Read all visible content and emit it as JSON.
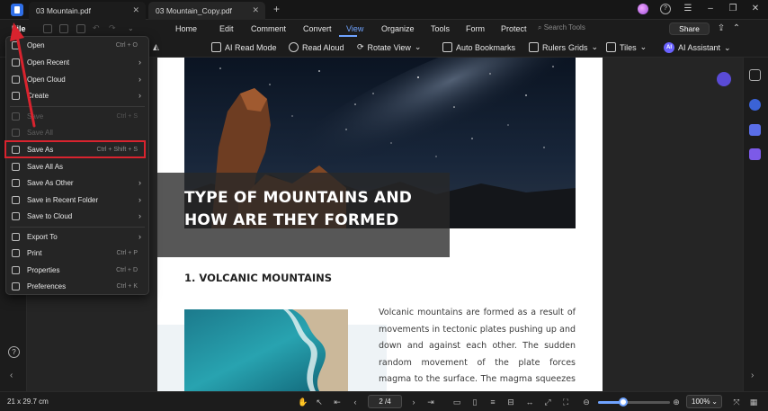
{
  "tabs": [
    {
      "label": "03 Mountain.pdf"
    },
    {
      "label": "03 Mountain_Copy.pdf"
    }
  ],
  "menubar": {
    "file": "File",
    "items": [
      {
        "label": "Home",
        "active": false
      },
      {
        "label": "Edit",
        "active": false
      },
      {
        "label": "Comment",
        "active": false
      },
      {
        "label": "Convert",
        "active": false
      },
      {
        "label": "View",
        "active": true
      },
      {
        "label": "Organize",
        "active": false
      },
      {
        "label": "Tools",
        "active": false
      },
      {
        "label": "Form",
        "active": false
      },
      {
        "label": "Protect",
        "active": false
      }
    ],
    "search_placeholder": "Search Tools",
    "share": "Share"
  },
  "toolbar": {
    "ai_read_mode": "AI Read Mode",
    "read_aloud": "Read Aloud",
    "rotate_view": "Rotate View",
    "auto_bookmarks": "Auto Bookmarks",
    "rulers": "Rulers",
    "grids": "Grids",
    "tiles": "Tiles",
    "ai_assistant": "AI Assistant",
    "ai_badge": "AI"
  },
  "file_menu": {
    "items": [
      {
        "label": "Open",
        "shortcut": "Ctrl + O",
        "submenu": false,
        "disabled": false
      },
      {
        "label": "Open Recent",
        "shortcut": "",
        "submenu": true,
        "disabled": false
      },
      {
        "label": "Open Cloud",
        "shortcut": "",
        "submenu": true,
        "disabled": false
      },
      {
        "label": "Create",
        "shortcut": "",
        "submenu": true,
        "disabled": false
      },
      {
        "label": "Save",
        "shortcut": "Ctrl + S",
        "submenu": false,
        "disabled": true
      },
      {
        "label": "Save All",
        "shortcut": "",
        "submenu": false,
        "disabled": true
      },
      {
        "label": "Save As",
        "shortcut": "Ctrl + Shift + S",
        "submenu": false,
        "disabled": false
      },
      {
        "label": "Save All As",
        "shortcut": "",
        "submenu": false,
        "disabled": false
      },
      {
        "label": "Save As Other",
        "shortcut": "",
        "submenu": true,
        "disabled": false
      },
      {
        "label": "Save in Recent Folder",
        "shortcut": "",
        "submenu": true,
        "disabled": false
      },
      {
        "label": "Save to Cloud",
        "shortcut": "",
        "submenu": true,
        "disabled": false
      },
      {
        "label": "Export To",
        "shortcut": "",
        "submenu": true,
        "disabled": false
      },
      {
        "label": "Print",
        "shortcut": "Ctrl + P",
        "submenu": false,
        "disabled": false
      },
      {
        "label": "Properties",
        "shortcut": "Ctrl + D",
        "submenu": false,
        "disabled": false
      },
      {
        "label": "Preferences",
        "shortcut": "Ctrl + K",
        "submenu": false,
        "disabled": false
      }
    ],
    "highlight_color": "#d9232e"
  },
  "document": {
    "title": "TYPE OF MOUNTAINS AND HOW ARE THEY FORMED",
    "section_heading": "1. VOLCANIC MOUNTAINS",
    "body": "Volcanic mountains are formed as a result of movements in tectonic plates pushing up and down and against each other. The sudden random movement of the plate forces magma to the surface. The magma squeezes itself through a vent"
  },
  "statusbar": {
    "page_size": "21 x 29.7 cm",
    "page_indicator": "2 /4",
    "zoom": "100%",
    "zoom_fraction": 0.35
  },
  "colors": {
    "accent": "#6fa3ff",
    "annotation_red": "#d9232e"
  }
}
